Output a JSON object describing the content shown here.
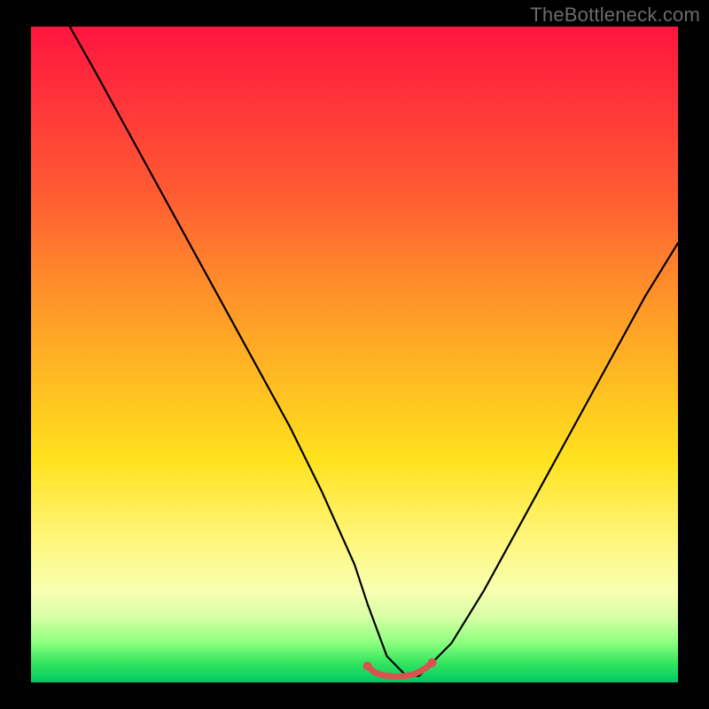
{
  "watermark": "TheBottleneck.com",
  "chart_data": {
    "type": "line",
    "title": "",
    "xlabel": "",
    "ylabel": "",
    "xlim": [
      0,
      100
    ],
    "ylim": [
      0,
      100
    ],
    "grid": false,
    "legend": false,
    "series": [
      {
        "name": "main-curve",
        "color": "#000000",
        "x": [
          6,
          10,
          15,
          20,
          25,
          30,
          35,
          40,
          45,
          50,
          52,
          55,
          58,
          60,
          65,
          70,
          75,
          80,
          85,
          90,
          95,
          100
        ],
        "y": [
          100,
          93,
          84,
          75,
          66,
          57,
          48,
          39,
          29,
          18,
          12,
          4,
          1,
          1,
          6,
          14,
          23,
          32,
          41,
          50,
          59,
          67
        ]
      },
      {
        "name": "bottom-marker-segment",
        "color": "#d9534f",
        "x": [
          52,
          53,
          54,
          55,
          56,
          57,
          58,
          59,
          60,
          61,
          62
        ],
        "y": [
          2.5,
          1.6,
          1.2,
          1.0,
          0.9,
          0.9,
          1.0,
          1.2,
          1.6,
          2.2,
          3.0
        ]
      }
    ],
    "gradient_background": {
      "direction": "top_to_bottom",
      "stops": [
        {
          "pos": 0.0,
          "color": "#ff153f"
        },
        {
          "pos": 0.25,
          "color": "#ff5a33"
        },
        {
          "pos": 0.55,
          "color": "#ffbf22"
        },
        {
          "pos": 0.78,
          "color": "#fff67a"
        },
        {
          "pos": 0.94,
          "color": "#8bff7e"
        },
        {
          "pos": 1.0,
          "color": "#00c864"
        }
      ]
    }
  }
}
